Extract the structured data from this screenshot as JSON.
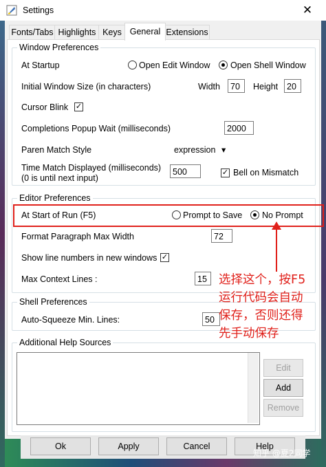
{
  "window": {
    "title": "Settings",
    "close_glyph": "✕"
  },
  "tabs": [
    {
      "label": "Fonts/Tabs",
      "active": false
    },
    {
      "label": "Highlights",
      "active": false
    },
    {
      "label": "Keys",
      "active": false
    },
    {
      "label": "General",
      "active": true
    },
    {
      "label": "Extensions",
      "active": false
    }
  ],
  "window_prefs": {
    "heading": "Window Preferences",
    "at_startup_label": "At Startup",
    "startup_options": [
      "Open Edit Window",
      "Open Shell Window"
    ],
    "startup_selected": "Open Shell Window",
    "initial_size_label": "Initial Window Size  (in characters)",
    "width_label": "Width",
    "width_value": "70",
    "height_label": "Height",
    "height_value": "20",
    "cursor_blink_label": "Cursor Blink",
    "cursor_blink_checked": true,
    "completions_label": "Completions Popup Wait (milliseconds)",
    "completions_value": "2000",
    "paren_label": "Paren Match Style",
    "paren_value": "expression",
    "time_match_label_1": "Time Match Displayed (milliseconds)",
    "time_match_label_2": "(0 is until next input)",
    "time_match_value": "500",
    "bell_label": "Bell on Mismatch",
    "bell_checked": true
  },
  "editor_prefs": {
    "heading": "Editor Preferences",
    "run_label": "At Start of Run (F5)",
    "run_options": [
      "Prompt to Save",
      "No Prompt"
    ],
    "run_selected": "No Prompt",
    "format_label": "Format Paragraph Max Width",
    "format_value": "72",
    "line_numbers_label": "Show line numbers in new windows",
    "line_numbers_checked": true,
    "context_label": "Max Context Lines :",
    "context_value": "15"
  },
  "shell_prefs": {
    "heading": "Shell Preferences",
    "squeeze_label": "Auto-Squeeze Min. Lines:",
    "squeeze_value": "50"
  },
  "help_sources": {
    "heading": "Additional Help Sources",
    "buttons": [
      "Edit",
      "Add",
      "Remove"
    ]
  },
  "footer_buttons": [
    "Ok",
    "Apply",
    "Cancel",
    "Help"
  ],
  "annotation": {
    "color": "#e0201a",
    "lines": [
      "选择这个，按F5",
      "运行代码会自动",
      "保存，否则还得",
      "先手动保存"
    ]
  },
  "watermark": "知乎 @夏2同学",
  "check_glyph": "✓",
  "dropdown_glyph": "▾"
}
